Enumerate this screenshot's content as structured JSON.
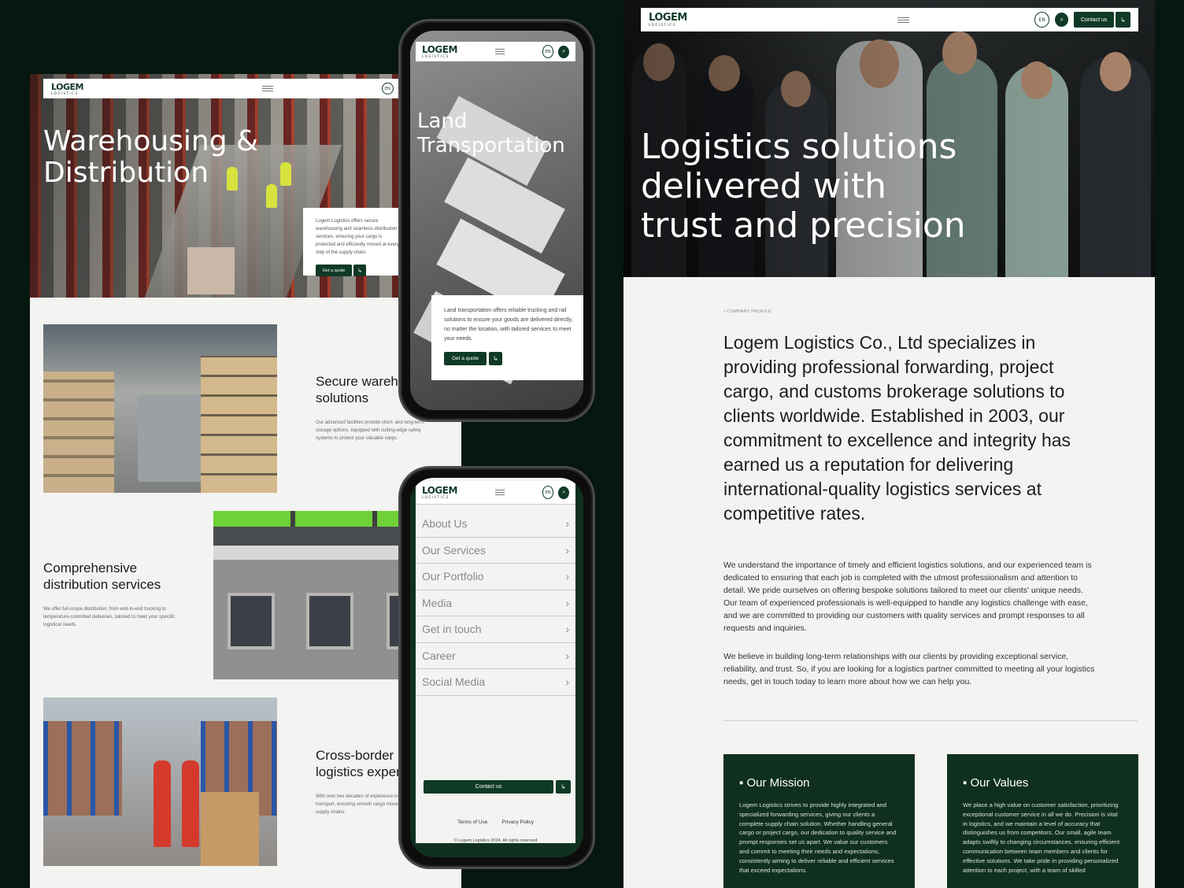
{
  "colors": {
    "brand_dark": "#0f3a26",
    "background": "#06170f",
    "page": "#f3f3f1",
    "accent_green": "#5fc832"
  },
  "brand": {
    "logo": "LOGEM",
    "logo_sub": "LOGISTICS"
  },
  "nav": {
    "lang": "EN",
    "search_icon": "search-icon",
    "menu_icon": "hamburger-icon",
    "contact_label": "Contact us",
    "arrow_icon": "arrow-icon"
  },
  "left_page": {
    "hero_title_line1": "Warehousing &",
    "hero_title_line2": "Distribution",
    "hero_card_text": "Logem Logistics offers secure warehousing and seamless distribution services, ensuring your cargo is protected and efficiently moved at every step of the supply chain.",
    "hero_card_button": "Get a quote",
    "services": [
      {
        "title_line1": "Secure warehousing",
        "title_line2": "solutions",
        "text": "Our advanced facilities provide short- and long-term storage options, equipped with cutting-edge safety systems to protect your valuable cargo."
      },
      {
        "title_line1": "Comprehensive",
        "title_line2": "distribution services",
        "text": "We offer full-scope distribution, from end-to-end trucking to temperature-controlled deliveries, tailored to meet your specific logistical needs."
      },
      {
        "title_line1": "Cross-border",
        "title_line2": "logistics expertise",
        "text": "With over two decades of experience in cross-border transport, ensuring smooth cargo movement across global supply chains."
      }
    ]
  },
  "phone_top": {
    "hero_title_line1": "Land",
    "hero_title_line2": "Transportation",
    "card_text": "Land transportation offers reliable trucking and rail solutions to ensure your goods are delivered directly, no matter the location, with tailored services to meet your needs.",
    "card_button": "Get a quote"
  },
  "phone_menu": {
    "items": [
      "About Us",
      "Our Services",
      "Our Portfolio",
      "Media",
      "Get in touch",
      "Career",
      "Social Media"
    ],
    "contact_button": "Contact us",
    "terms": "Terms of Use",
    "privacy": "Privacy Policy",
    "copyright": "© Logem Logistics 2024. All rights reserved"
  },
  "right_page": {
    "hero_title_line1": "Logistics solutions",
    "hero_title_line2": "delivered with",
    "hero_title_line3": "trust and precision",
    "eyebrow": "COMPANY PROFILE",
    "lead": "Logem Logistics Co., Ltd specializes in providing professional forwarding, project cargo, and customs brokerage solutions to clients worldwide. Established in 2003, our commitment to excellence and integrity has earned us a reputation for delivering international-quality logistics services at competitive rates.",
    "para1": "We understand the importance of timely and efficient logistics solutions, and our experienced team is dedicated to ensuring that each job is completed with the utmost professionalism and attention to detail. We pride ourselves on offering bespoke solutions tailored to meet our clients' unique needs. Our team of experienced professionals is well-equipped to handle any logistics challenge with ease, and we are committed to providing our customers with quality services and prompt responses to all requests and inquiries.",
    "para2": "We believe in building long-term relationships with our clients by providing exceptional service, reliability, and trust. So, if you are looking for a logistics partner committed to meeting all your logistics needs, get in touch today to learn more about how we can help you.",
    "mission_title": "Our Mission",
    "mission_text": "Logem Logistics strives to provide highly integrated and specialized forwarding services, giving our clients a complete supply chain solution. Whether handling general cargo or project cargo, our dedication to quality service and prompt responses set us apart. We value our customers and commit to meeting their needs and expectations, consistently aiming to deliver reliable and efficient services that exceed expectations.",
    "values_title": "Our Values",
    "values_text": "We place a high value on customer satisfaction, prioritizing exceptional customer service in all we do. Precision is vital in logistics, and we maintain a level of accuracy that distinguishes us from competitors. Our small, agile team adapts swiftly to changing circumstances, ensuring efficient communication between team members and clients for effective solutions. We take pride in providing personalized attention to each project, with a team of skilled"
  }
}
